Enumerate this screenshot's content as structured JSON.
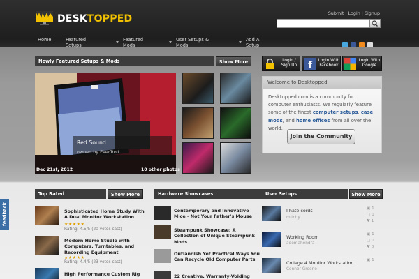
{
  "header": {
    "logo": "DESKTOPPED",
    "top_links": [
      "Submit",
      "Login",
      "Signup"
    ],
    "nav": [
      "Home",
      "Featured Setups",
      "Featured Mods",
      "User Setups & Mods",
      "Add A Setup"
    ],
    "social": [
      "twitter-icon",
      "facebook-icon",
      "rss-icon",
      "mail-icon"
    ]
  },
  "featured": {
    "title": "Newly Featured Setups & Mods",
    "more": "Show More",
    "caption_title": "Red Sound",
    "caption_owner": "owned by EverTroll",
    "date": "Dec 21st, 2012",
    "photos": "10 other photos"
  },
  "login": {
    "signup": "Login / Sign Up",
    "facebook": "Login With Facebook",
    "google": "Login With Google"
  },
  "welcome": {
    "title": "Welcome to Desktopped",
    "body_1": "Desktopped.com is a community for computer enthusiasts. We regularly feature some of the finest ",
    "link_1": "computer setups",
    "body_2": ", ",
    "link_2": "case mods",
    "body_3": ", and ",
    "link_3": "home offices",
    "body_4": " from all over the world.",
    "join": "Join the Community"
  },
  "top_rated": {
    "title": "Top Rated",
    "more": "Show More",
    "items": [
      {
        "title": "Sophisticated Home Study With A Dual Monitor Workstation",
        "rating": "Rating: 4.5/5 (20 votes cast)"
      },
      {
        "title": "Modern Home Studio with Computers, Turntables, and Recording Equipment",
        "rating": "Rating: 4.4/5 (23 votes cast)"
      },
      {
        "title": "High Performance Custom Rig",
        "rating": ""
      }
    ]
  },
  "hardware": {
    "title": "Hardware Showcases",
    "items": [
      "Contemporary and Innovative Mice - Not Your Father's Mouse",
      "Steampunk Showcase: A Collection of Unique Steampunk Mods",
      "Outlandish Yet Practical Ways You Can Recycle Old Computer Parts",
      "22 Creative, Warranty-Voiding"
    ]
  },
  "user_setups": {
    "title": "User Setups",
    "more": "Show More",
    "items": [
      {
        "title": "I hate cords",
        "user": "mitchy",
        "stats": [
          "1",
          "0",
          "1"
        ]
      },
      {
        "title": "Working Room",
        "user": "ademahendra",
        "stats": [
          "1",
          "0",
          "0"
        ]
      },
      {
        "title": "College 4 Monitor Workstation",
        "user": "Connor Greene",
        "stats": [
          "1",
          "",
          ""
        ]
      }
    ]
  },
  "feedback": "feedback"
}
